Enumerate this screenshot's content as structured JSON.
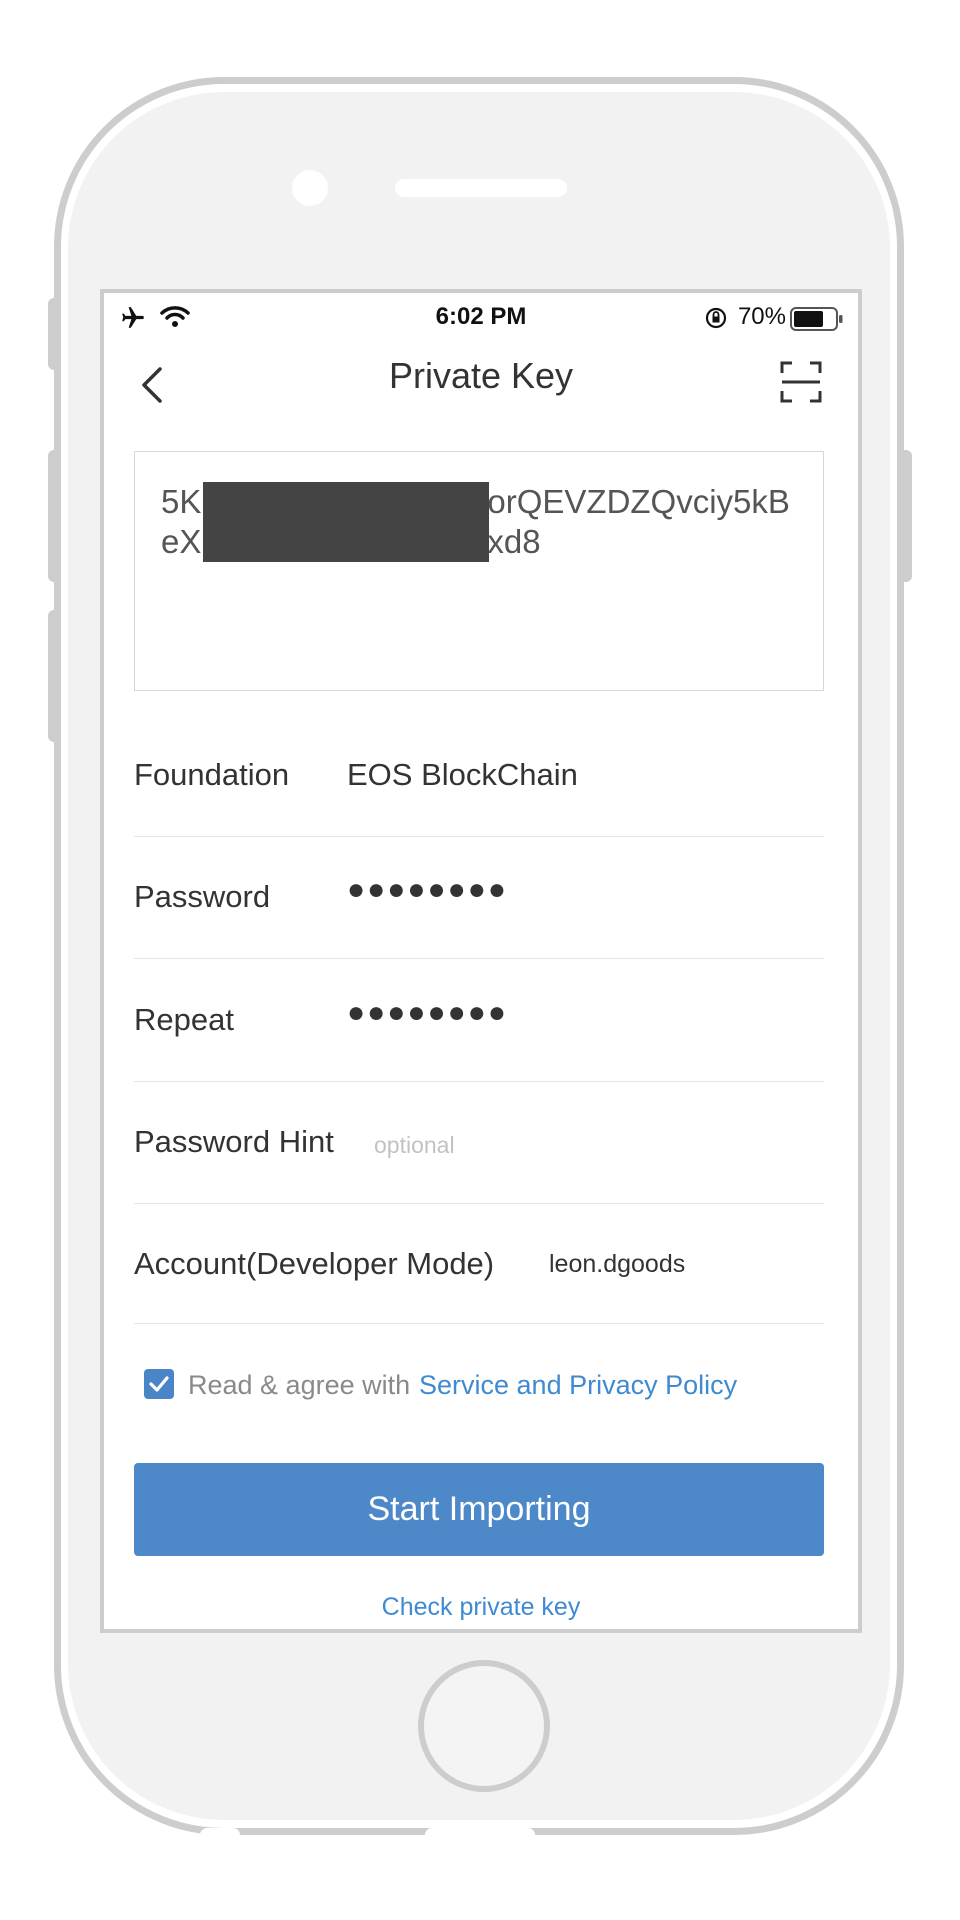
{
  "status_bar": {
    "time": "6:02 PM",
    "battery_percent": "70%"
  },
  "nav": {
    "title": "Private Key"
  },
  "private_key": {
    "line1": "5K",
    "line1_end": "orQEVZDZQvciy5kB",
    "line2": "eX",
    "line2_end": "xd8"
  },
  "form": {
    "foundation_label": "Foundation",
    "foundation_value": "EOS BlockChain",
    "password_label": "Password",
    "password_mask": "●●●●●●●●",
    "repeat_label": "Repeat",
    "repeat_mask": "●●●●●●●●",
    "hint_label": "Password Hint",
    "hint_placeholder": "optional",
    "account_label": "Account(Developer Mode)",
    "account_value": "leon.dgoods"
  },
  "agreement": {
    "checked": true,
    "text": "Read & agree with",
    "link": "Service and Privacy Policy"
  },
  "actions": {
    "primary": "Start Importing",
    "secondary": "Check private key"
  },
  "colors": {
    "accent": "#4d88c9",
    "link": "#3f8ad0",
    "redaction": "#444444"
  }
}
